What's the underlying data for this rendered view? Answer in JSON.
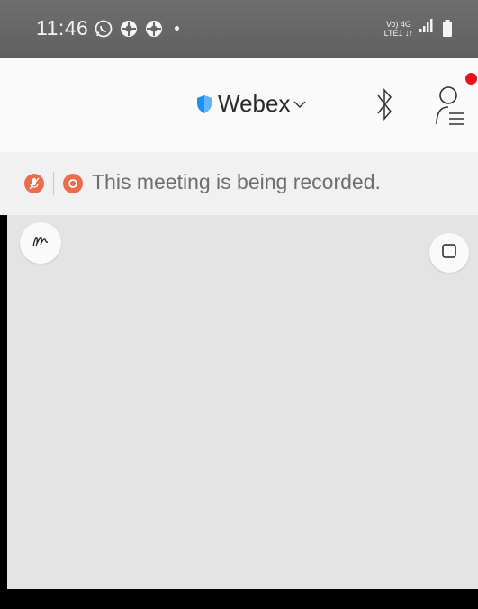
{
  "status_bar": {
    "time": "11:46",
    "icons": [
      "whatsapp-icon",
      "app-icon",
      "app-icon",
      "dot-icon"
    ],
    "network_label_top": "Vo) 4G",
    "network_label_bottom": "LTE1 ↓↑",
    "right_icons": [
      "signal-icon",
      "battery-icon"
    ]
  },
  "header": {
    "site_name": "Webex",
    "icons": {
      "shield": "shield-icon",
      "dropdown": "chevron-down-icon",
      "bluetooth": "bluetooth-icon",
      "participants": "participants-icon"
    },
    "notification_color": "#e8121b"
  },
  "recording_banner": {
    "message": "This meeting is being recorded.",
    "accent_color": "#ec6c4e"
  },
  "content": {
    "annotate_icon": "annotate-icon",
    "stop_icon": "stop-share-icon",
    "background": "#e4e4e4"
  },
  "colors": {
    "status_bar": "#666666",
    "header_bg": "#fafafa",
    "brand_blue": "#1d8ff5"
  }
}
